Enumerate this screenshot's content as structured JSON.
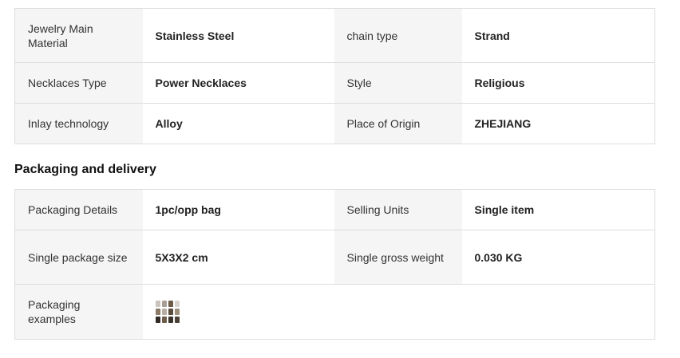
{
  "attributes": {
    "rows": [
      [
        {
          "key": "Jewelry Main Material",
          "value": "Stainless Steel"
        },
        {
          "key": "chain type",
          "value": "Strand"
        }
      ],
      [
        {
          "key": "Necklaces Type",
          "value": "Power Necklaces"
        },
        {
          "key": "Style",
          "value": "Religious"
        }
      ],
      [
        {
          "key": "Inlay technology",
          "value": "Alloy"
        },
        {
          "key": "Place of Origin",
          "value": "ZHEJIANG"
        }
      ]
    ]
  },
  "packaging": {
    "title": "Packaging and delivery",
    "rows": [
      [
        {
          "key": "Packaging Details",
          "value": "1pc/opp bag"
        },
        {
          "key": "Selling Units",
          "value": "Single item"
        }
      ],
      [
        {
          "key": "Single package size",
          "value": "5X3X2 cm"
        },
        {
          "key": "Single gross weight",
          "value": "0.030 KG"
        }
      ],
      [
        {
          "key": "Packaging examples",
          "image": "packaging-examples-thumbnail"
        }
      ]
    ]
  }
}
